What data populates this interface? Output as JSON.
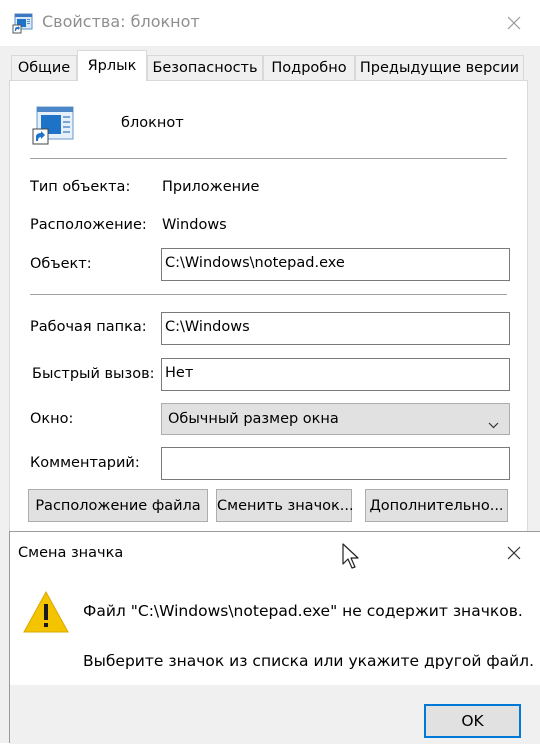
{
  "window": {
    "title": "Свойства: блокнот",
    "icon": "notepad-shortcut-icon"
  },
  "tabs": [
    {
      "label": "Общие",
      "active": false
    },
    {
      "label": "Ярлык",
      "active": true
    },
    {
      "label": "Безопасность",
      "active": false
    },
    {
      "label": "Подробно",
      "active": false
    },
    {
      "label": "Предыдущие версии",
      "active": false
    }
  ],
  "shortcut": {
    "name": "блокнот",
    "icon": "shortcut-app-icon",
    "target_type_label": "Тип объекта:",
    "target_type_value": "Приложение",
    "location_label": "Расположение:",
    "location_value": "Windows",
    "target_label": "Объект:",
    "target_value": "C:\\Windows\\notepad.exe",
    "start_in_label": "Рабочая папка:",
    "start_in_value": "C:\\Windows",
    "hotkey_label": "Быстрый вызов:",
    "hotkey_value": "Нет",
    "run_label": "Окно:",
    "run_value": "Обычный размер окна",
    "comment_label": "Комментарий:",
    "comment_value": ""
  },
  "buttons": {
    "open_location": "Расположение файла",
    "change_icon": "Сменить значок...",
    "advanced": "Дополнительно..."
  },
  "dialog": {
    "title": "Смена значка",
    "line1": "Файл \"C:\\Windows\\notepad.exe\" не содержит значков.",
    "line2": "Выберите значок из списка или укажите другой файл.",
    "ok_label": "OK",
    "icon": "warning-icon"
  },
  "colors": {
    "accent": "#0078d7",
    "warning": "#f5c400"
  }
}
